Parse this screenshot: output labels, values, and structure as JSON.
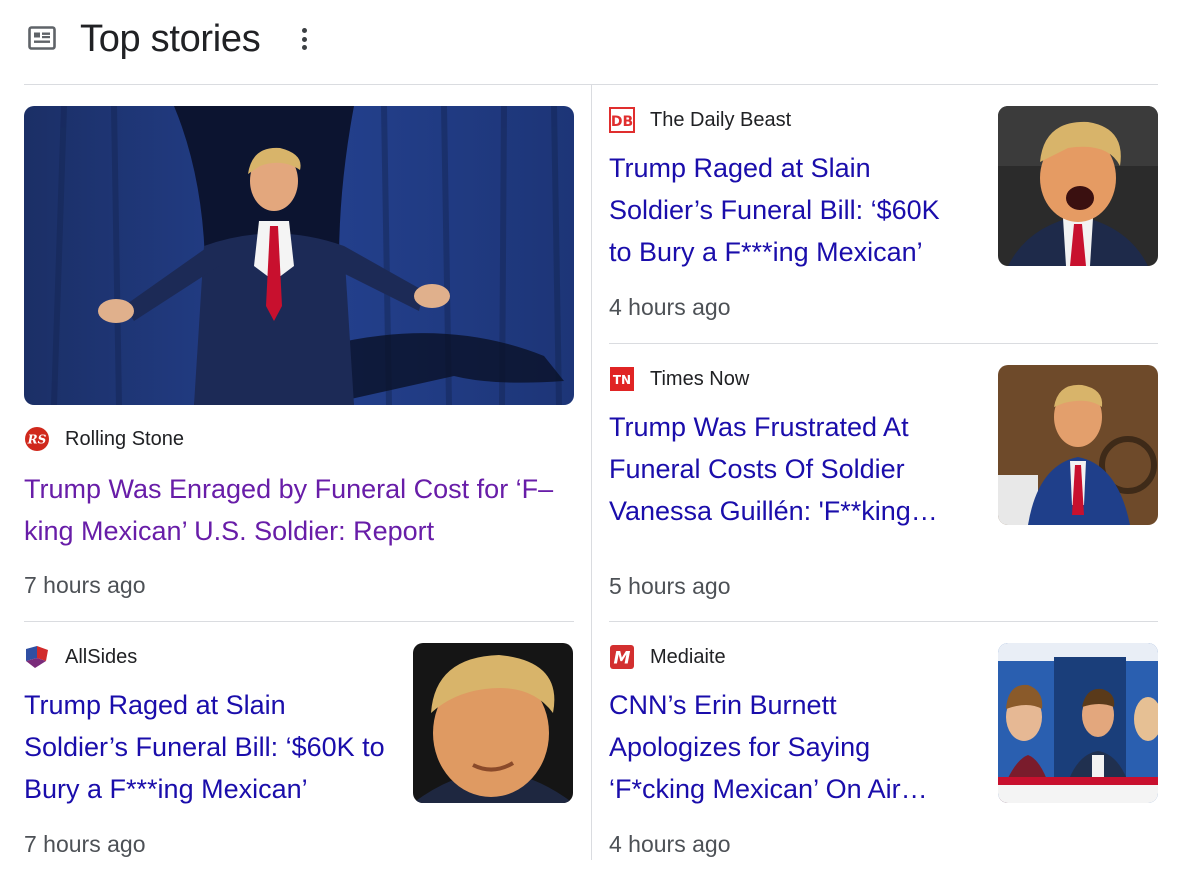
{
  "section": {
    "title": "Top stories",
    "icon": "newspaper-icon",
    "menu_icon": "more-vert-icon"
  },
  "colors": {
    "link": "#1a0dab",
    "visited_link": "#681da8",
    "meta": "#4d5156",
    "divider": "#dadce0"
  },
  "stories": [
    {
      "source": "Rolling Stone",
      "logo": "rolling-stone-logo",
      "title": "Trump Was Enraged by Funeral Cost for ‘F–king Mexican’ U.S. Soldier: Report",
      "time": "7 hours ago",
      "visited": true
    },
    {
      "source": "The Daily Beast",
      "logo": "daily-beast-logo",
      "title": "Trump Raged at Slain Soldier’s Funeral Bill: ‘$60K to Bury a F***ing Mexican’",
      "time": "4 hours ago"
    },
    {
      "source": "Times Now",
      "logo": "times-now-logo",
      "title": "Trump Was Frustrated At Funeral Costs Of Soldier Vanessa Guillén: 'F**king…",
      "time": "5 hours ago"
    },
    {
      "source": "AllSides",
      "logo": "allsides-logo",
      "title": "Trump Raged at Slain Soldier’s Funeral Bill: ‘$60K to Bury a F***ing Mexican’",
      "time": "7 hours ago"
    },
    {
      "source": "Mediaite",
      "logo": "mediaite-logo",
      "title": "CNN’s Erin Burnett Apologizes for Saying ‘F*cking Mexican’ On Air…",
      "time": "4 hours ago"
    }
  ]
}
